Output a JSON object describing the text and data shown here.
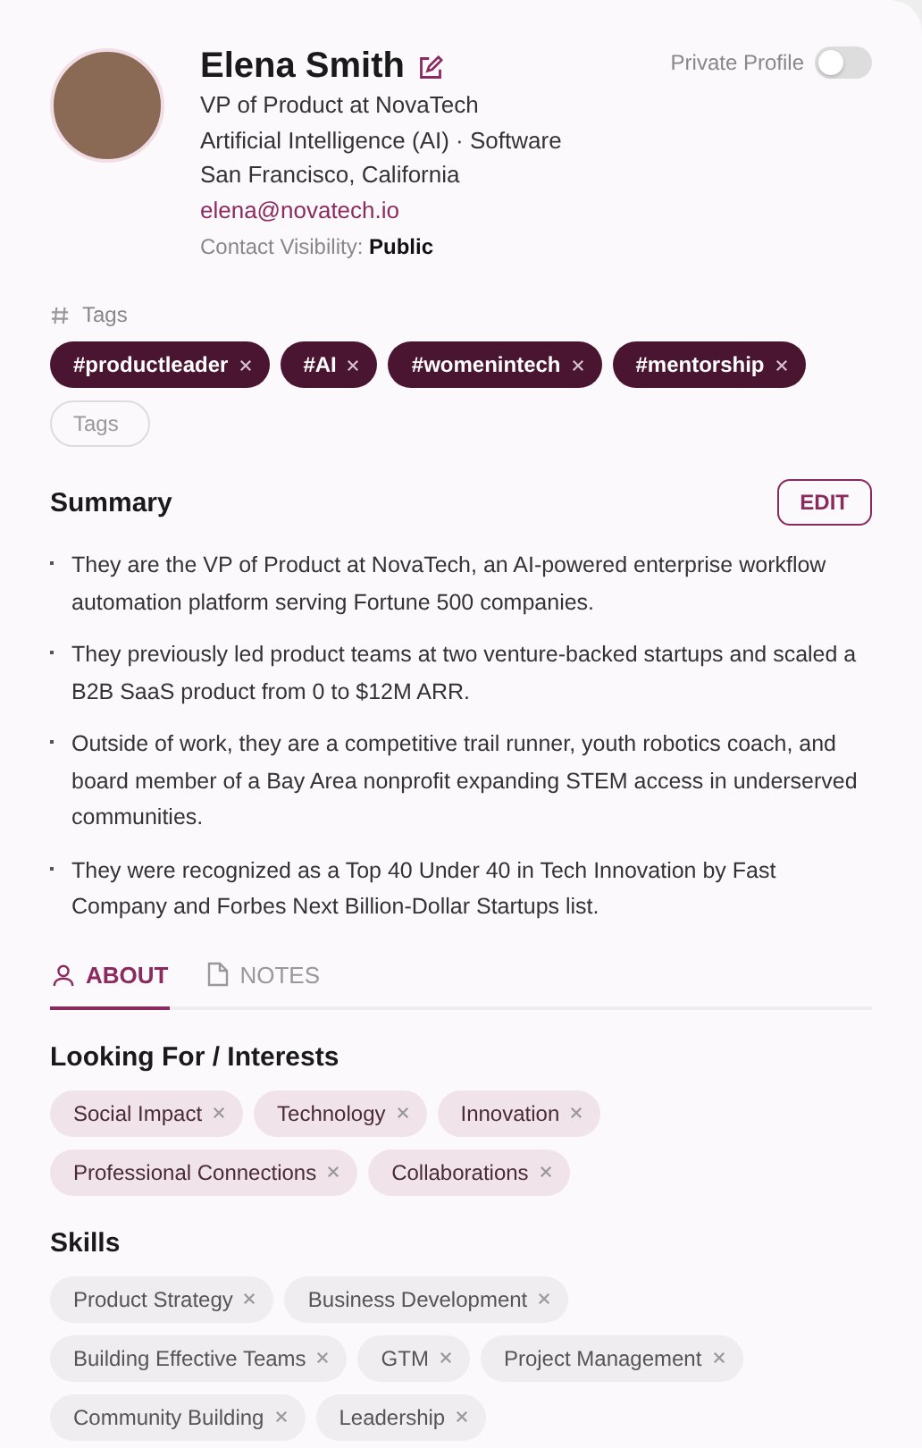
{
  "profile": {
    "name": "Elena Smith",
    "title": "VP of Product at NovaTech",
    "industry": "Artificial Intelligence (AI) · Software",
    "location": "San Francisco, California",
    "email": "elena@novatech.io",
    "visibility_label": "Contact Visibility:",
    "visibility_value": "Public"
  },
  "private_profile": {
    "label": "Private Profile",
    "on": false
  },
  "tags": {
    "label": "Tags",
    "items": [
      "#productleader",
      "#AI",
      "#womenintech",
      "#mentorship"
    ],
    "placeholder": "Tags"
  },
  "summary": {
    "title": "Summary",
    "edit_button": "EDIT",
    "bullets": [
      "They are the VP of Product at NovaTech, an AI-powered enterprise workflow automation platform serving Fortune 500 companies.",
      "They previously led product teams at two venture-backed startups and scaled a B2B SaaS product from 0 to $12M ARR.",
      "Outside of work, they are a competitive trail runner, youth robotics coach, and board member of a Bay Area nonprofit expanding STEM access in underserved communities.",
      "They were recognized as a Top 40 Under 40 in Tech Innovation by Fast Company and Forbes Next Billion-Dollar Startups list."
    ]
  },
  "tabs": [
    {
      "label": "ABOUT",
      "kind": "person",
      "selected": true
    },
    {
      "label": "NOTES",
      "kind": "document",
      "selected": false
    }
  ],
  "interests": {
    "title": "Looking For / Interests",
    "items": [
      "Social Impact",
      "Technology",
      "Innovation",
      "Professional Connections",
      "Collaborations"
    ]
  },
  "skills": {
    "title": "Skills",
    "items": [
      "Product Strategy",
      "Business Development",
      "Building Effective Teams",
      "GTM",
      "Project Management",
      "Community Building",
      "Leadership"
    ]
  }
}
